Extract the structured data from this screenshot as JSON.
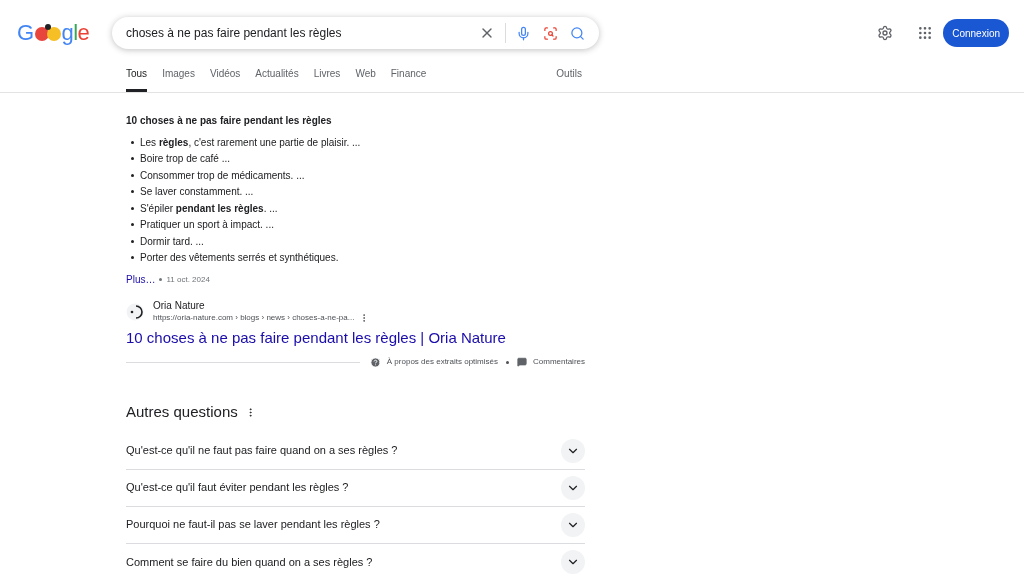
{
  "logo": {
    "parts": [
      {
        "text": "G",
        "color": "#4285f4"
      },
      {
        "kind": "doodle"
      },
      {
        "text": "g",
        "color": "#4285f4"
      },
      {
        "text": "l",
        "color": "#34a853"
      },
      {
        "text": "e",
        "color": "#ea4335"
      }
    ]
  },
  "search": {
    "value": "choses à ne pas faire pendant les règles"
  },
  "sign_in": "Connexion",
  "tabs": [
    {
      "label": "Tous",
      "selected": true
    },
    {
      "label": "Images",
      "selected": false
    },
    {
      "label": "Vidéos",
      "selected": false
    },
    {
      "label": "Actualités",
      "selected": false
    },
    {
      "label": "Livres",
      "selected": false
    },
    {
      "label": "Web",
      "selected": false
    },
    {
      "label": "Finance",
      "selected": false
    }
  ],
  "tools": "Outils",
  "snippet": {
    "title": "10 choses à ne pas faire pendant les règles",
    "items": [
      "Les **règles**, c'est rarement une partie de plaisir. ...",
      "Boire trop de café ...",
      "Consommer trop de médicaments. ...",
      "Se laver constamment. ...",
      "S'épiler **pendant les règles**. ...",
      "Pratiquer un sport à impact. ...",
      "Dormir tard. ...",
      "Porter des vêtements serrés et synthétiques."
    ],
    "more": "Plus…",
    "date": "11 oct. 2024",
    "site": "Oria Nature",
    "url": "https://oria-nature.com › blogs › news › choses-a-ne-pa...",
    "link": "10 choses à ne pas faire pendant les règles | Oria Nature",
    "about": "À propos des extraits optimisés",
    "feedback": "Commentaires"
  },
  "questions": {
    "title": "Autres questions",
    "items": [
      {
        "text": "Qu'est-ce qu'il ne faut pas faire quand on a ses règles ?",
        "expanded": false
      },
      {
        "text": "Qu'est-ce qu'il faut éviter pendant les règles ?",
        "expanded": false
      },
      {
        "text": "Pourquoi ne faut-il pas se laver pendant les règles ?",
        "expanded": false
      },
      {
        "text": "Comment se faire du bien quand on a ses règles ?",
        "expanded": false
      }
    ]
  }
}
